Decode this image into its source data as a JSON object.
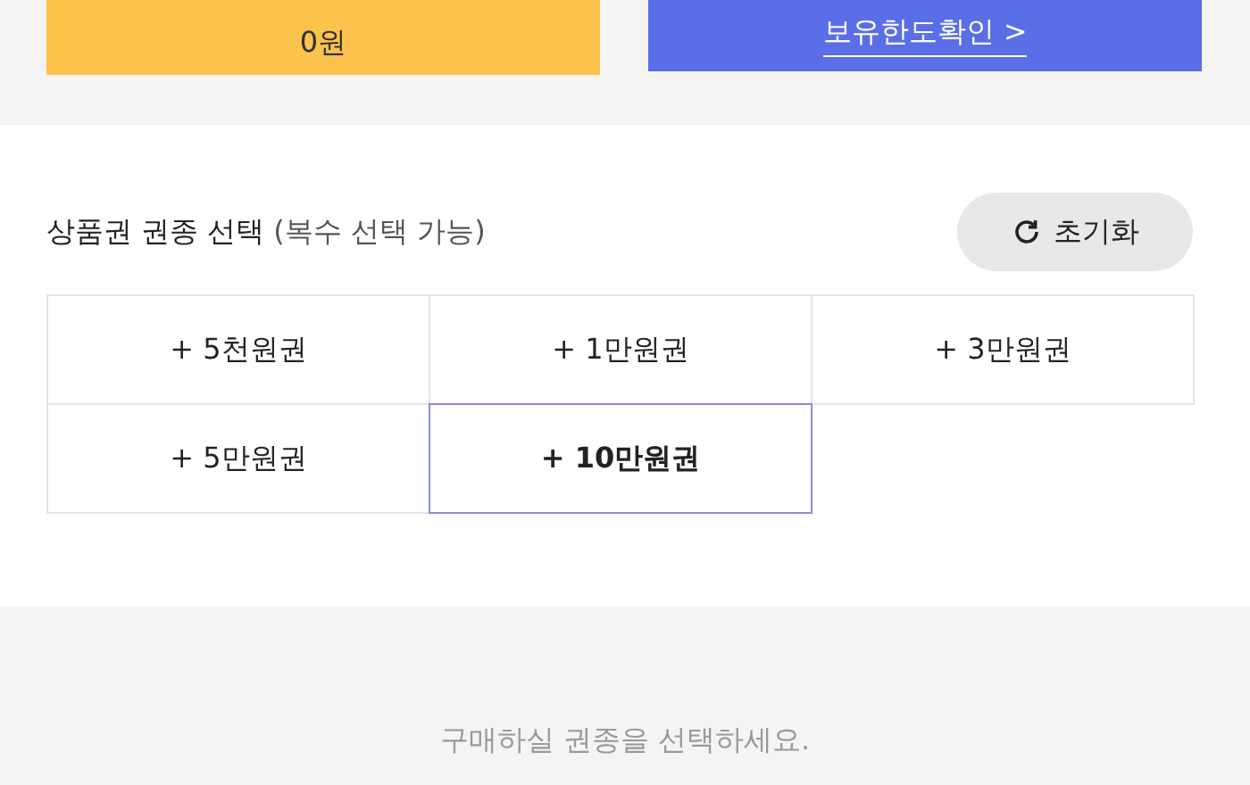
{
  "top_buttons": {
    "amount": "0원",
    "limit_link": "보유한도확인 >"
  },
  "section": {
    "title": "상품권 권종 선택",
    "subtitle": "(복수 선택 가능)",
    "reset": "초기화",
    "options": [
      {
        "label": "+ 5천원권",
        "selected": false
      },
      {
        "label": "+ 1만원권",
        "selected": false
      },
      {
        "label": "+ 3만원권",
        "selected": false
      },
      {
        "label": "+ 5만원권",
        "selected": false
      },
      {
        "label": "+ 10만원권",
        "selected": true
      }
    ]
  },
  "hint": "구매하실 권종을 선택하세요."
}
